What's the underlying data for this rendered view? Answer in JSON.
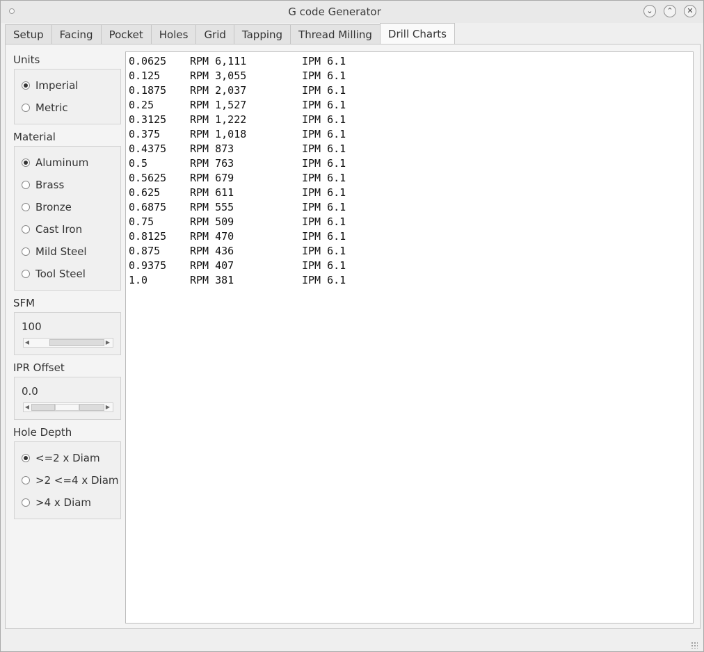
{
  "window": {
    "title": "G code Generator"
  },
  "titlebar_buttons": [
    {
      "name": "minimize",
      "glyph": "⌄"
    },
    {
      "name": "maximize",
      "glyph": "⌃"
    },
    {
      "name": "close",
      "glyph": "✕"
    }
  ],
  "tabs": [
    {
      "label": "Setup",
      "active": false
    },
    {
      "label": "Facing",
      "active": false
    },
    {
      "label": "Pocket",
      "active": false
    },
    {
      "label": "Holes",
      "active": false
    },
    {
      "label": "Grid",
      "active": false
    },
    {
      "label": "Tapping",
      "active": false
    },
    {
      "label": "Thread Milling",
      "active": false
    },
    {
      "label": "Drill Charts",
      "active": true
    }
  ],
  "units": {
    "title": "Units",
    "options": [
      {
        "label": "Imperial",
        "checked": true
      },
      {
        "label": "Metric",
        "checked": false
      }
    ]
  },
  "material": {
    "title": "Material",
    "options": [
      {
        "label": "Aluminum",
        "checked": true
      },
      {
        "label": "Brass",
        "checked": false
      },
      {
        "label": "Bronze",
        "checked": false
      },
      {
        "label": "Cast Iron",
        "checked": false
      },
      {
        "label": "Mild Steel",
        "checked": false
      },
      {
        "label": "Tool Steel",
        "checked": false
      }
    ]
  },
  "sfm": {
    "title": "SFM",
    "value": "100"
  },
  "ipr_offset": {
    "title": "IPR Offset",
    "value": "0.0"
  },
  "hole_depth": {
    "title": "Hole Depth",
    "options": [
      {
        "label": "<=2 x Diam",
        "checked": true
      },
      {
        "label": ">2 <=4 x Diam",
        "checked": false
      },
      {
        "label": ">4 x Diam",
        "checked": false
      }
    ]
  },
  "chart": {
    "rows": [
      {
        "diam": "0.0625",
        "rpm": "RPM 6,111",
        "ipm": "IPM 6.1"
      },
      {
        "diam": "0.125",
        "rpm": "RPM 3,055",
        "ipm": "IPM 6.1"
      },
      {
        "diam": "0.1875",
        "rpm": "RPM 2,037",
        "ipm": "IPM 6.1"
      },
      {
        "diam": "0.25",
        "rpm": "RPM 1,527",
        "ipm": "IPM 6.1"
      },
      {
        "diam": "0.3125",
        "rpm": "RPM 1,222",
        "ipm": "IPM 6.1"
      },
      {
        "diam": "0.375",
        "rpm": "RPM 1,018",
        "ipm": "IPM 6.1"
      },
      {
        "diam": "0.4375",
        "rpm": "RPM 873",
        "ipm": "IPM 6.1"
      },
      {
        "diam": "0.5",
        "rpm": "RPM 763",
        "ipm": "IPM 6.1"
      },
      {
        "diam": "0.5625",
        "rpm": "RPM 679",
        "ipm": "IPM 6.1"
      },
      {
        "diam": "0.625",
        "rpm": "RPM 611",
        "ipm": "IPM 6.1"
      },
      {
        "diam": "0.6875",
        "rpm": "RPM 555",
        "ipm": "IPM 6.1"
      },
      {
        "diam": "0.75",
        "rpm": "RPM 509",
        "ipm": "IPM 6.1"
      },
      {
        "diam": "0.8125",
        "rpm": "RPM 470",
        "ipm": "IPM 6.1"
      },
      {
        "diam": "0.875",
        "rpm": "RPM 436",
        "ipm": "IPM 6.1"
      },
      {
        "diam": "0.9375",
        "rpm": "RPM 407",
        "ipm": "IPM 6.1"
      },
      {
        "diam": "1.0",
        "rpm": "RPM 381",
        "ipm": "IPM 6.1"
      }
    ]
  }
}
